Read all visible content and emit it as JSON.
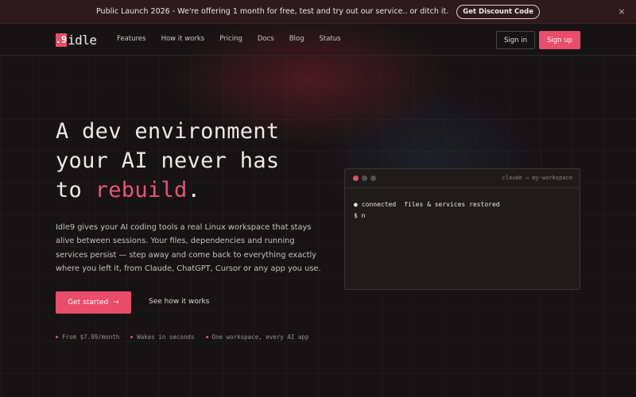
{
  "announcement": {
    "text": "Public Launch 2026 - We're offering 1 month for free, test and try out our service.. or ditch it.",
    "button": "Get Discount Code",
    "close": "×"
  },
  "nav": {
    "logo_mark": ".9",
    "logo_text": "idle",
    "links": [
      "Features",
      "How it works",
      "Pricing",
      "Docs",
      "Blog",
      "Status"
    ],
    "signin": "Sign in",
    "signup": "Sign up"
  },
  "hero": {
    "title_line1": "A dev environment",
    "title_line2": "your AI never has",
    "title_line3_pre": "to ",
    "title_line3_accent": "rebuild",
    "title_line3_post": ".",
    "description": "Idle9 gives your AI coding tools a real Linux workspace that stays alive between sessions. Your files, dependencies and running services persist — step away and come back to everything exactly where you left it, from Claude, ChatGPT, Cursor or any app you use.",
    "cta_primary": "Get started",
    "cta_arrow": "→",
    "cta_secondary": "See how it works",
    "features": [
      "From $7.99/month",
      "Wakes in seconds",
      "One workspace, every AI app"
    ]
  },
  "terminal": {
    "title": "claude → my-workspace",
    "line1_bullet": "●",
    "line1_status": "connected",
    "line1_detail": "files & services restored",
    "line2": "$ n"
  },
  "colors": {
    "accent": "#ea4c6b",
    "background": "#161314",
    "announcement_bg": "#2c1a1e"
  }
}
